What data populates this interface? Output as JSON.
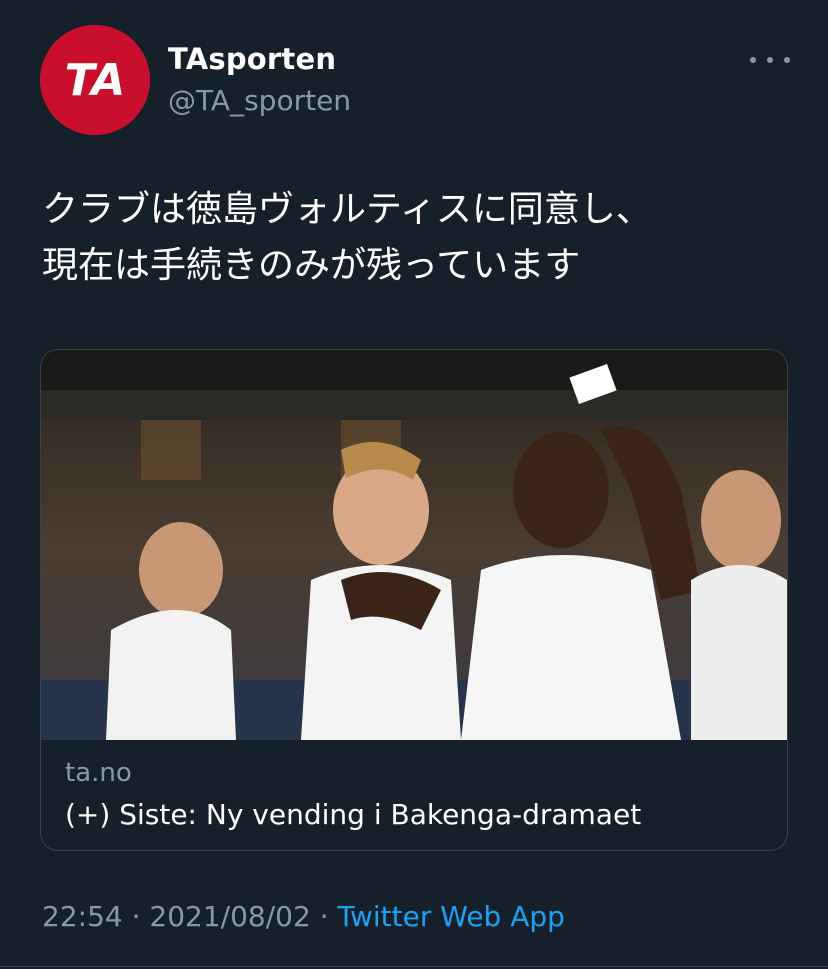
{
  "author": {
    "display_name": "TAsporten",
    "handle": "@TA_sporten",
    "avatar_text": "TA"
  },
  "tweet": {
    "text": "クラブは徳島ヴォルティスに同意し、\n現在は手続きのみが残っています"
  },
  "card": {
    "domain": "ta.no",
    "title": "(+) Siste: Ny vending i Bakenga-dramaet",
    "image_icon": "football-players-photo"
  },
  "meta": {
    "time": "22:54",
    "separator": "·",
    "date": "2021/08/02",
    "source": "Twitter Web App"
  },
  "colors": {
    "background": "#15202b",
    "secondary_text": "#8899a6",
    "link": "#1da1f2",
    "border": "#38444d",
    "avatar": "#c8102e"
  }
}
